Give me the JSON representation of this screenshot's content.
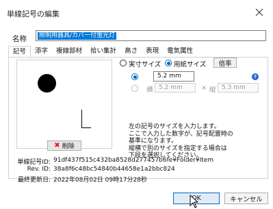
{
  "window": {
    "title": "単線記号の編集"
  },
  "name": {
    "label": "名称",
    "value": "照明用器具/カバー付蛍光灯"
  },
  "tabs": [
    {
      "label": "記号"
    },
    {
      "label": "添字"
    },
    {
      "label": "複線部材"
    },
    {
      "label": "拾い集計"
    },
    {
      "label": "高さ"
    },
    {
      "label": "表現"
    },
    {
      "label": "電気属性"
    }
  ],
  "preview": {
    "delete_label": "削除"
  },
  "size": {
    "actual_label": "実寸サイズ",
    "paper_label": "用紙サイズ",
    "scale_button": "倍率",
    "value": "5.2 mm",
    "width_label": "横",
    "width_value": "5.2 mm",
    "times": "×",
    "height_label": "縦",
    "height_value": "5.3 mm",
    "selected": "paper"
  },
  "description": [
    "左の記号のサイズを入力します。",
    "ここで入力した数字が、記号配置時の",
    "基準になります。",
    "縦横で別のサイズを指定する場合は",
    "下段を選択してください。"
  ],
  "meta": {
    "id_label": "単線記号ID:",
    "id_value": "91df437f515c432ba8528d277457b6fe¥Folder¥Item",
    "rev_label": "Rev. ID:",
    "rev_value": "38a8f6c48bc54840b44658e1a2bbc824",
    "date_label": "最終更新日:",
    "date_value": "2022年08月02日 09時17分28秒"
  },
  "footer": {
    "ok_label": "OK",
    "cancel_label": "キャンセル"
  },
  "colors": {
    "accent": "#0067c0",
    "selection": "#0078d7",
    "delete_x": "#e81123"
  }
}
